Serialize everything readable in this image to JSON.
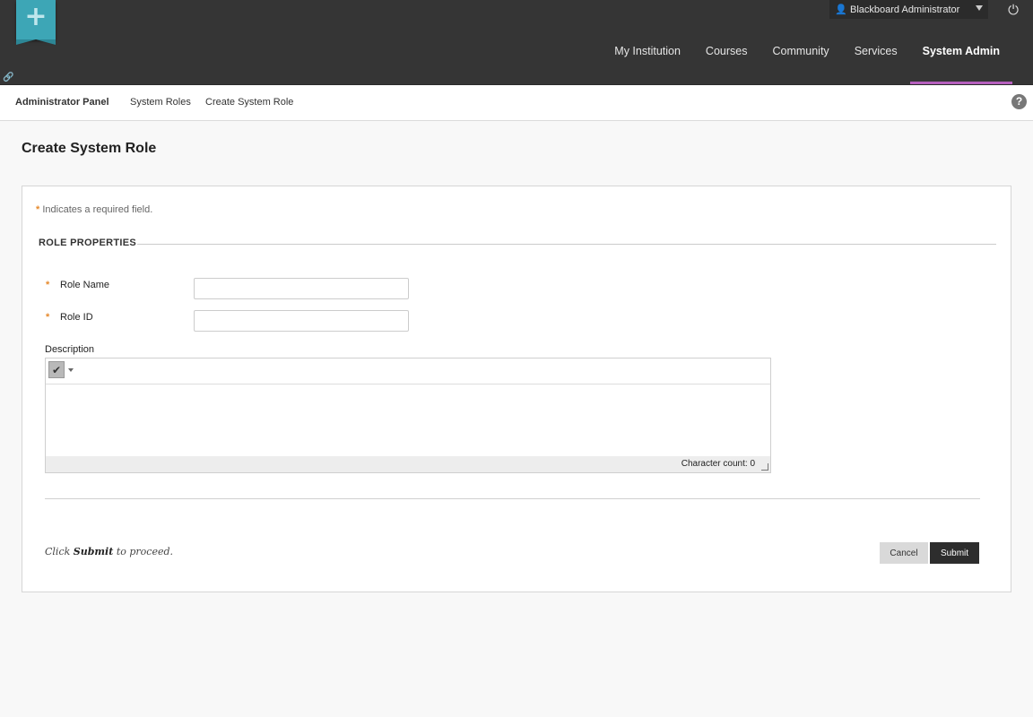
{
  "header": {
    "user_name": "Blackboard Administrator",
    "tabs": [
      {
        "label": "My Institution",
        "active": false
      },
      {
        "label": "Courses",
        "active": false
      },
      {
        "label": "Community",
        "active": false
      },
      {
        "label": "Services",
        "active": false
      },
      {
        "label": "System Admin",
        "active": true
      }
    ],
    "accent_color": "#b55fbd",
    "logo_color": "#3da6b6"
  },
  "breadcrumb": [
    "Administrator Panel",
    "System Roles",
    "Create System Role"
  ],
  "page": {
    "title": "Create System Role"
  },
  "form": {
    "required_note": "Indicates a required field.",
    "section_title": "ROLE PROPERTIES",
    "fields": {
      "role_name": {
        "label": "Role Name",
        "value": ""
      },
      "role_id": {
        "label": "Role ID",
        "value": ""
      }
    },
    "description_label": "Description",
    "character_count": "Character count: 0",
    "proceed_pre": "Click ",
    "proceed_bold": "Submit",
    "proceed_post": " to proceed.",
    "cancel_label": "Cancel",
    "submit_label": "Submit"
  }
}
